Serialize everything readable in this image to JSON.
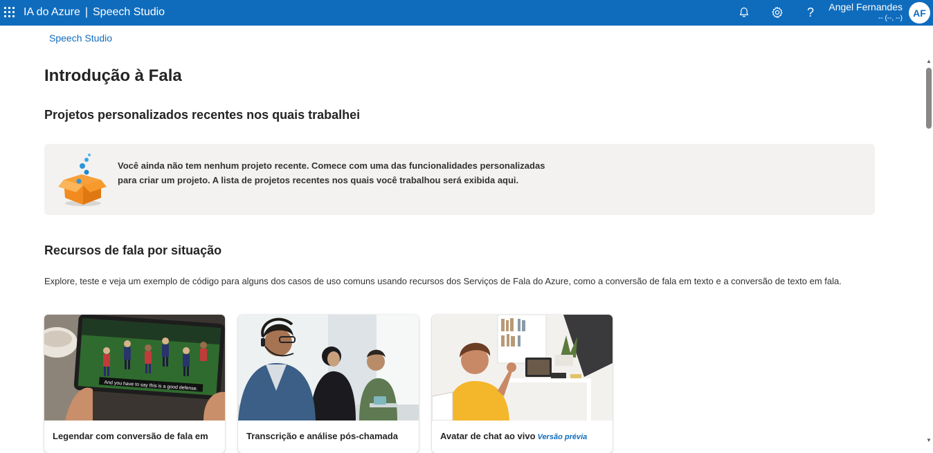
{
  "header": {
    "app_name": "IA do Azure",
    "separator": "|",
    "product": "Speech Studio",
    "icons": [
      "waffle-icon",
      "bell-icon",
      "gear-icon",
      "help-icon"
    ],
    "help_glyph": "?",
    "user_name": "Angel Fernandes",
    "user_sub": "-- (--, --)",
    "avatar_initials": "AF",
    "bar_color": "#0f6cbd"
  },
  "breadcrumb": {
    "item": "Speech Studio"
  },
  "page": {
    "title": "Introdução à Fala",
    "recent_heading": "Projetos personalizados recentes nos quais trabalhei",
    "empty_message": "Você ainda não tem nenhum projeto recente. Comece com uma das funcionalidades personalizadas para criar um projeto. A lista de projetos recentes nos quais você trabalhou será exibida aqui.",
    "scenarios_heading": "Recursos de fala por situação",
    "scenarios_desc": "Explore, teste e veja um exemplo de código para alguns dos casos de uso comuns usando recursos dos Serviços de Fala do Azure, como a conversão de fala em texto e a conversão de texto em fala."
  },
  "cards": [
    {
      "title": "Legendar com conversão de fala em",
      "image_caption": "And you have to say this is a good defense.",
      "preview": ""
    },
    {
      "title": "Transcrição e análise pós-chamada",
      "preview": ""
    },
    {
      "title": "Avatar de chat ao vivo",
      "preview": "Versão prévia"
    }
  ]
}
